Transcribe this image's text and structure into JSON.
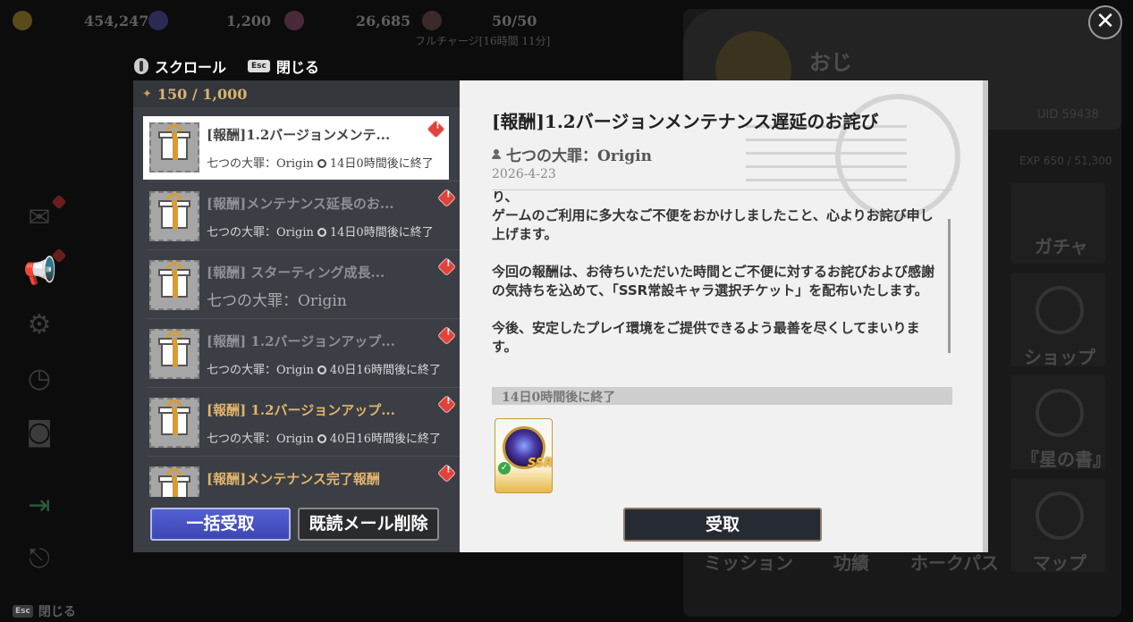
{
  "background": {
    "resources": [
      {
        "icon": "gold-coin-icon",
        "value": "454,247"
      },
      {
        "icon": "star-gem-icon",
        "value": "1,200"
      },
      {
        "icon": "moon-gem-icon",
        "value": "26,685"
      },
      {
        "icon": "stamina-icon",
        "value": "50/50"
      }
    ],
    "stamina_sub": "フルチャージ[16時間 11分]",
    "profile_name": "おじ",
    "uid": "UID 59438",
    "exp": "EXP 650 / 51,300",
    "tiles": {
      "gacha": "ガチャ",
      "shop": "ショップ",
      "star_book": "『星の書』",
      "mission": "ミッション",
      "feats": "功績",
      "hawk_pass": "ホークパス",
      "map": "マップ"
    },
    "close_label": "閉じる",
    "esc_key": "Esc"
  },
  "hints": {
    "scroll_label": "スクロール",
    "esc_key": "Esc",
    "close_label": "閉じる"
  },
  "mail": {
    "count": "150 / 1,000",
    "items": [
      {
        "title": "[報酬]1.2バージョンメンテ...",
        "sub": "七つの大罪：Origin",
        "expiry": "14日0時間後に終了",
        "title_color": "#444444",
        "sub_color": "#444444"
      },
      {
        "title": "[報酬]メンテナンス延長のお...",
        "sub": "七つの大罪：Origin",
        "expiry": "14日0時間後に終了",
        "title_color": "#8e9095",
        "sub_color": "#d8d8d8"
      },
      {
        "title": "[報酬] スターティング成長...",
        "sub": "七つの大罪：Origin",
        "expiry": "",
        "title_color": "#8e9095",
        "sub_color": "#aaaaaa"
      },
      {
        "title": "[報酬] 1.2バージョンアップ...",
        "sub": "七つの大罪：Origin",
        "expiry": "40日16時間後に終了",
        "title_color": "#8e9095",
        "sub_color": "#d8d8d8"
      },
      {
        "title": "[報酬] 1.2バージョンアップ...",
        "sub": "七つの大罪：Origin",
        "expiry": "40日16時間後に終了",
        "title_color": "#e0b46c",
        "sub_color": "#d8d8d8"
      },
      {
        "title": "[報酬]メンテナンス完了報酬",
        "sub": "",
        "expiry": "",
        "title_color": "#e0b46c",
        "sub_color": "#d8d8d8"
      }
    ],
    "bulk_button": "一括受取",
    "delete_button": "既読メール削除"
  },
  "detail": {
    "title": "[報酬]1.2バージョンメンテナンス遅延のお詫び",
    "sender": "七つの大罪：Origin",
    "date": "2026-4-23",
    "body": "り、\nゲームのご利用に多大なご不便をおかけしましたこと、心よりお詫び申し上げます。\n\n今回の報酬は、お待ちいただいた時間とご不便に対するお詫びおよび感謝の気持ちを込めて、「SSR常設キャラ選択チケット」を配布いたします。\n\n今後、安定したプレイ環境をご提供できるよう最善を尽くしてまいります。",
    "expiry": "14日0時間後に終了",
    "reward_badge": "SSR",
    "claim_button": "受取"
  }
}
